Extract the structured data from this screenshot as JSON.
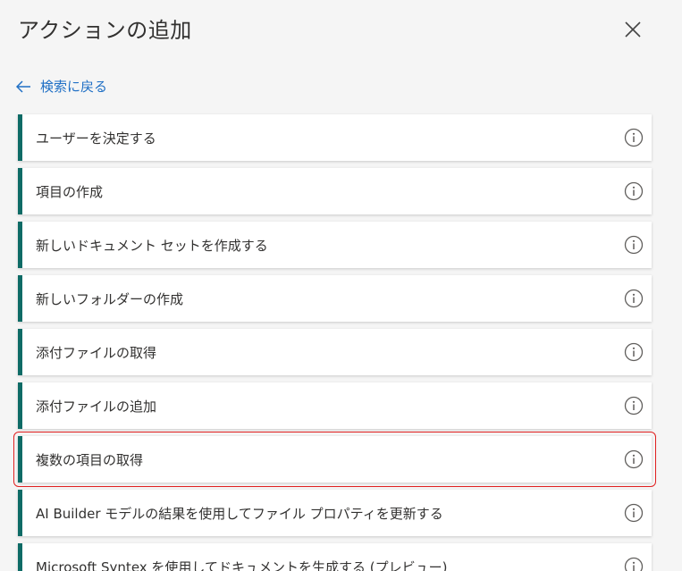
{
  "header": {
    "title": "アクションの追加"
  },
  "back": {
    "label": "検索に戻る"
  },
  "actions": [
    {
      "label": "ユーザーを決定する"
    },
    {
      "label": "項目の作成"
    },
    {
      "label": "新しいドキュメント セットを作成する"
    },
    {
      "label": "新しいフォルダーの作成"
    },
    {
      "label": "添付ファイルの取得"
    },
    {
      "label": "添付ファイルの追加"
    },
    {
      "label": "複数の項目の取得",
      "highlighted": true
    },
    {
      "label": "AI Builder モデルの結果を使用してファイル プロパティを更新する"
    },
    {
      "label": "Microsoft Syntex を使用してドキュメントを生成する (プレビュー)"
    }
  ],
  "colors": {
    "accent_bar": "#0e6b66",
    "link": "#1f6fc5",
    "highlight": "#e02020"
  },
  "icons": {
    "close": "close-icon",
    "back": "arrow-left-icon",
    "info": "info-icon"
  }
}
